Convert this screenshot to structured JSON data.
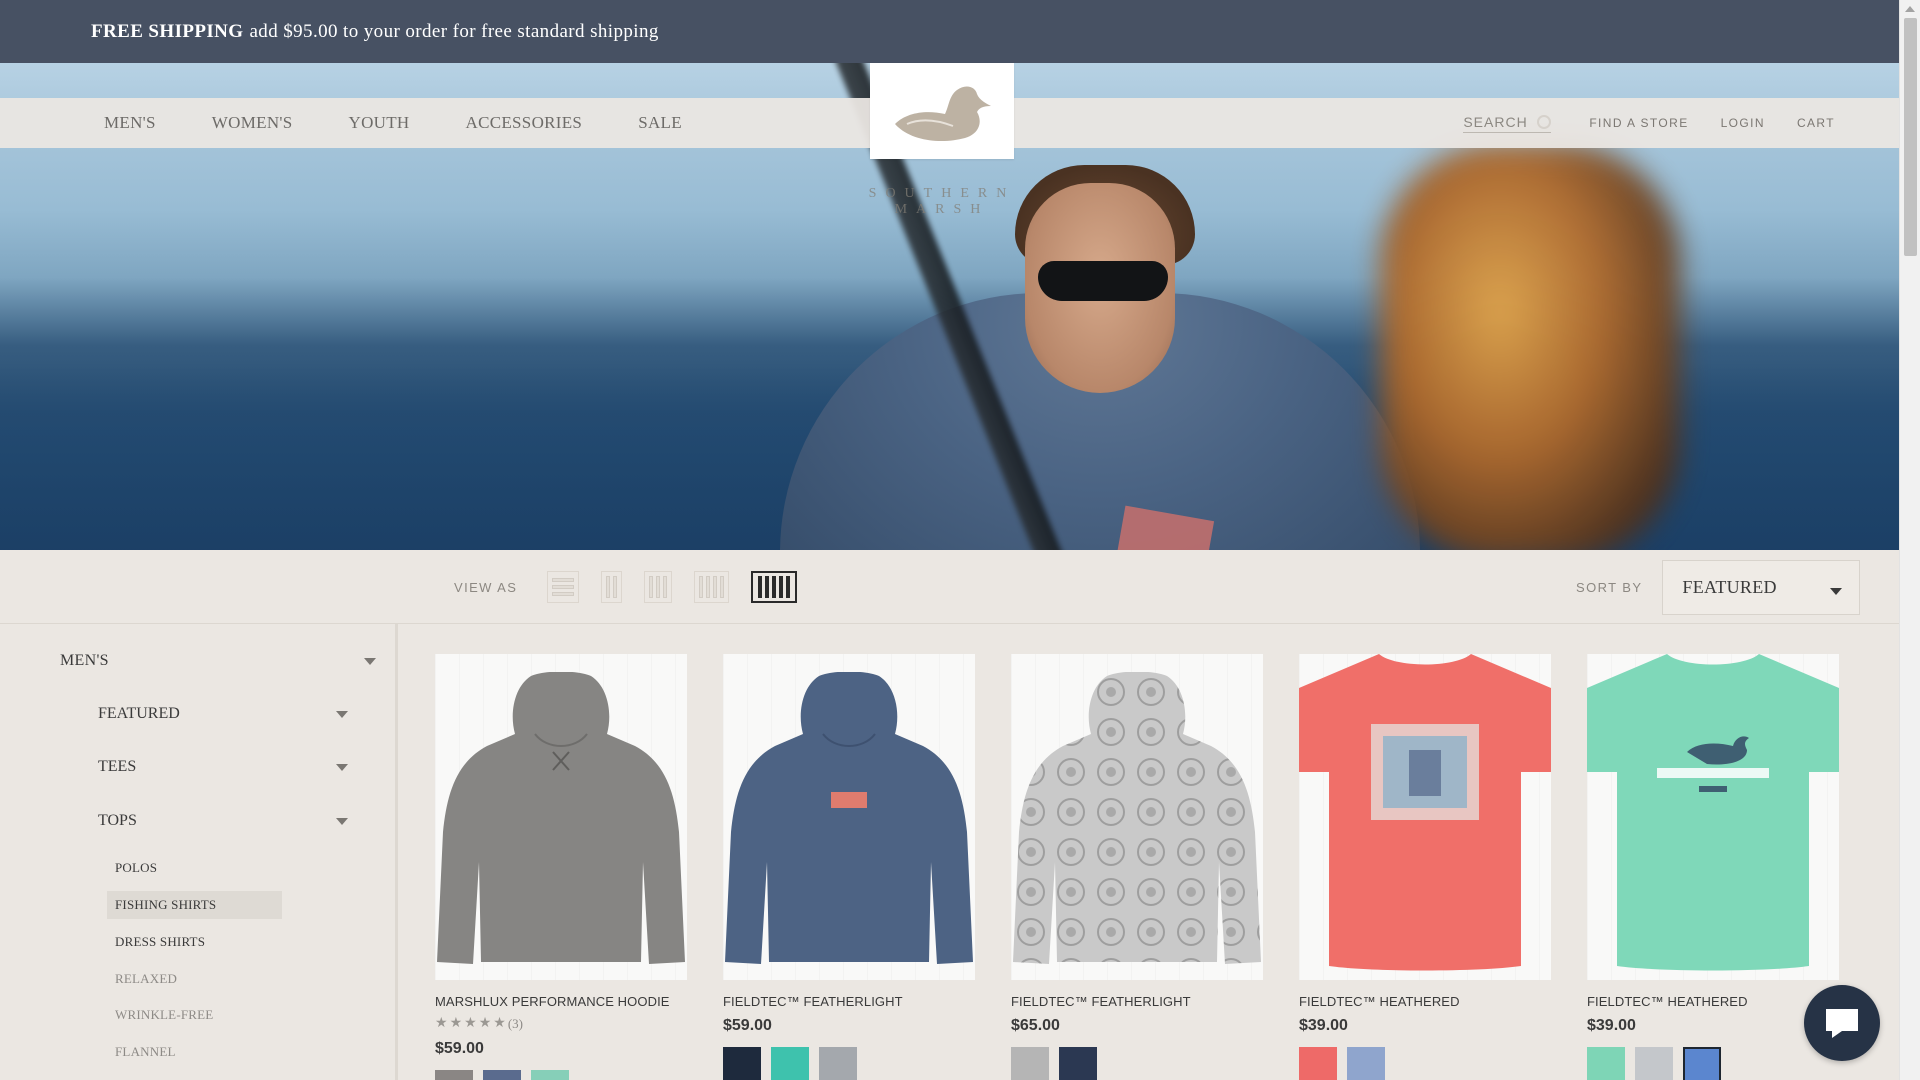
{
  "promo": {
    "strong": "FREE SHIPPING",
    "text": "add $95.00 to your order for free standard shipping"
  },
  "nav": {
    "items": [
      "MEN'S",
      "WOMEN'S",
      "YOUTH",
      "ACCESSORIES",
      "SALE"
    ],
    "search_label": "SEARCH",
    "links": [
      "FIND A STORE",
      "LOGIN",
      "CART"
    ]
  },
  "brand": {
    "name": "SOUTHERN MARSH"
  },
  "toolbar": {
    "view_as": "VIEW AS",
    "sort_by": "SORT BY",
    "sort_value": "FEATURED"
  },
  "sidebar": {
    "top": "MEN'S",
    "sections": [
      "FEATURED",
      "TEES",
      "TOPS"
    ],
    "leaves": [
      {
        "label": "POLOS",
        "state": "normal"
      },
      {
        "label": "FISHING SHIRTS",
        "state": "active"
      },
      {
        "label": "DRESS SHIRTS",
        "state": "normal"
      },
      {
        "label": "RELAXED",
        "state": "muted"
      },
      {
        "label": "WRINKLE-FREE",
        "state": "muted"
      },
      {
        "label": "FLANNEL",
        "state": "muted"
      }
    ]
  },
  "products": [
    {
      "name": "MARSHLUX PERFORMANCE HOODIE",
      "rating_count": "(3)",
      "price": "$59.00",
      "swatches": [
        "#8a8684",
        "#5a6b8e",
        "#86cfb8"
      ]
    },
    {
      "name": "FIELDTEC™ FEATHERLIGHT",
      "price": "$59.00",
      "swatches": [
        "#1e2a3d",
        "#3ec2ad",
        "#a4a8ad"
      ]
    },
    {
      "name": "FIELDTEC™ FEATHERLIGHT",
      "price": "$65.00",
      "swatches": [
        "#b5b5b5",
        "#2b3852"
      ]
    },
    {
      "name": "FIELDTEC™ HEATHERED",
      "price": "$39.00",
      "swatches": [
        "#ee6a68",
        "#8fa5cd"
      ]
    },
    {
      "name": "FIELDTEC™ HEATHERED",
      "price": "$39.00",
      "swatches": [
        "#7ed5b6",
        "#c4c7cb",
        "#5b86cf"
      ]
    }
  ],
  "colors": {
    "promo_bg": "#475163",
    "page_bg": "#ebe7e2",
    "chat_bg": "#263346"
  }
}
